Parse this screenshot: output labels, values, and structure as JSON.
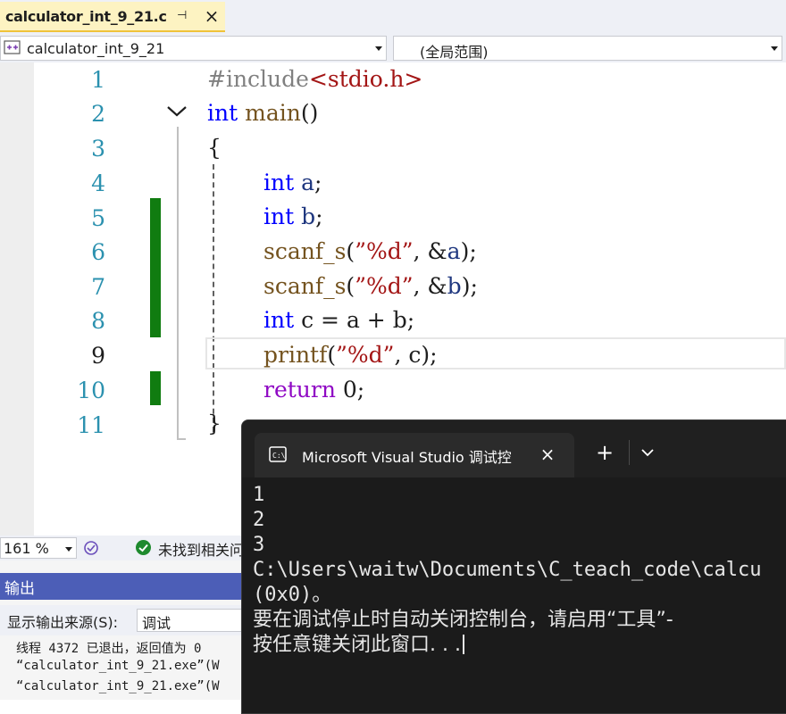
{
  "tab": {
    "title": "calculator_int_9_21.c",
    "pin": "⊣",
    "close": "×"
  },
  "navbar": {
    "scope": "calculator_int_9_21",
    "function": "(全局范围)"
  },
  "editor": {
    "line_numbers": [
      "1",
      "2",
      "3",
      "4",
      "5",
      "6",
      "7",
      "8",
      "9",
      "10",
      "11"
    ],
    "current_line": "9",
    "lines": {
      "l1_pp": "#include",
      "l1_inc": "<stdio.h>",
      "l2_kw": "int",
      "l2_fn": "main",
      "l2_rest": "()",
      "l3": "{",
      "l4_kw": "int",
      "l4_var": "a",
      "l4_rest": ";",
      "l5_kw": "int",
      "l5_var": "b",
      "l5_rest": ";",
      "l6_fn": "scanf_s",
      "l6_p1": "(",
      "l6_str": "”%d”",
      "l6_p2": ", &",
      "l6_var": "a",
      "l6_p3": ");",
      "l7_fn": "scanf_s",
      "l7_p1": "(",
      "l7_str": "”%d”",
      "l7_p2": ", &",
      "l7_var": "b",
      "l7_p3": ");",
      "l8_kw": "int",
      "l8_rest": "c = a + b;",
      "l9_fn": "printf",
      "l9_p1": "(",
      "l9_str": "”%d”",
      "l9_p2": ", c);",
      "l10_kw": "return",
      "l10_rest": "0;",
      "l11": "}"
    }
  },
  "status": {
    "zoom": "161 %",
    "message": "未找到相关问"
  },
  "output": {
    "title": "输出",
    "source_label": "显示输出来源(S):",
    "source_value": "调试",
    "lines": [
      "线程 4372 已退出，返回值为 0",
      "“calculator_int_9_21.exe”(W",
      "“calculator_int_9_21.exe”(W"
    ]
  },
  "console": {
    "tab_title": "Microsoft Visual Studio 调试控",
    "close": "×",
    "new_tab": "+",
    "lines": [
      "1",
      "2",
      "3",
      "C:\\Users\\waitw\\Documents\\C_teach_code\\calcu",
      "(0x0)。",
      "要在调试停止时自动关闭控制台，请启用“工具”-",
      "按任意键关闭此窗口. . ."
    ]
  },
  "colors": {
    "accent": "#4c5eb7",
    "tab_active": "#fdf3c2",
    "change_bar": "#107c10",
    "keyword": "#0000ff",
    "string": "#a31515"
  }
}
